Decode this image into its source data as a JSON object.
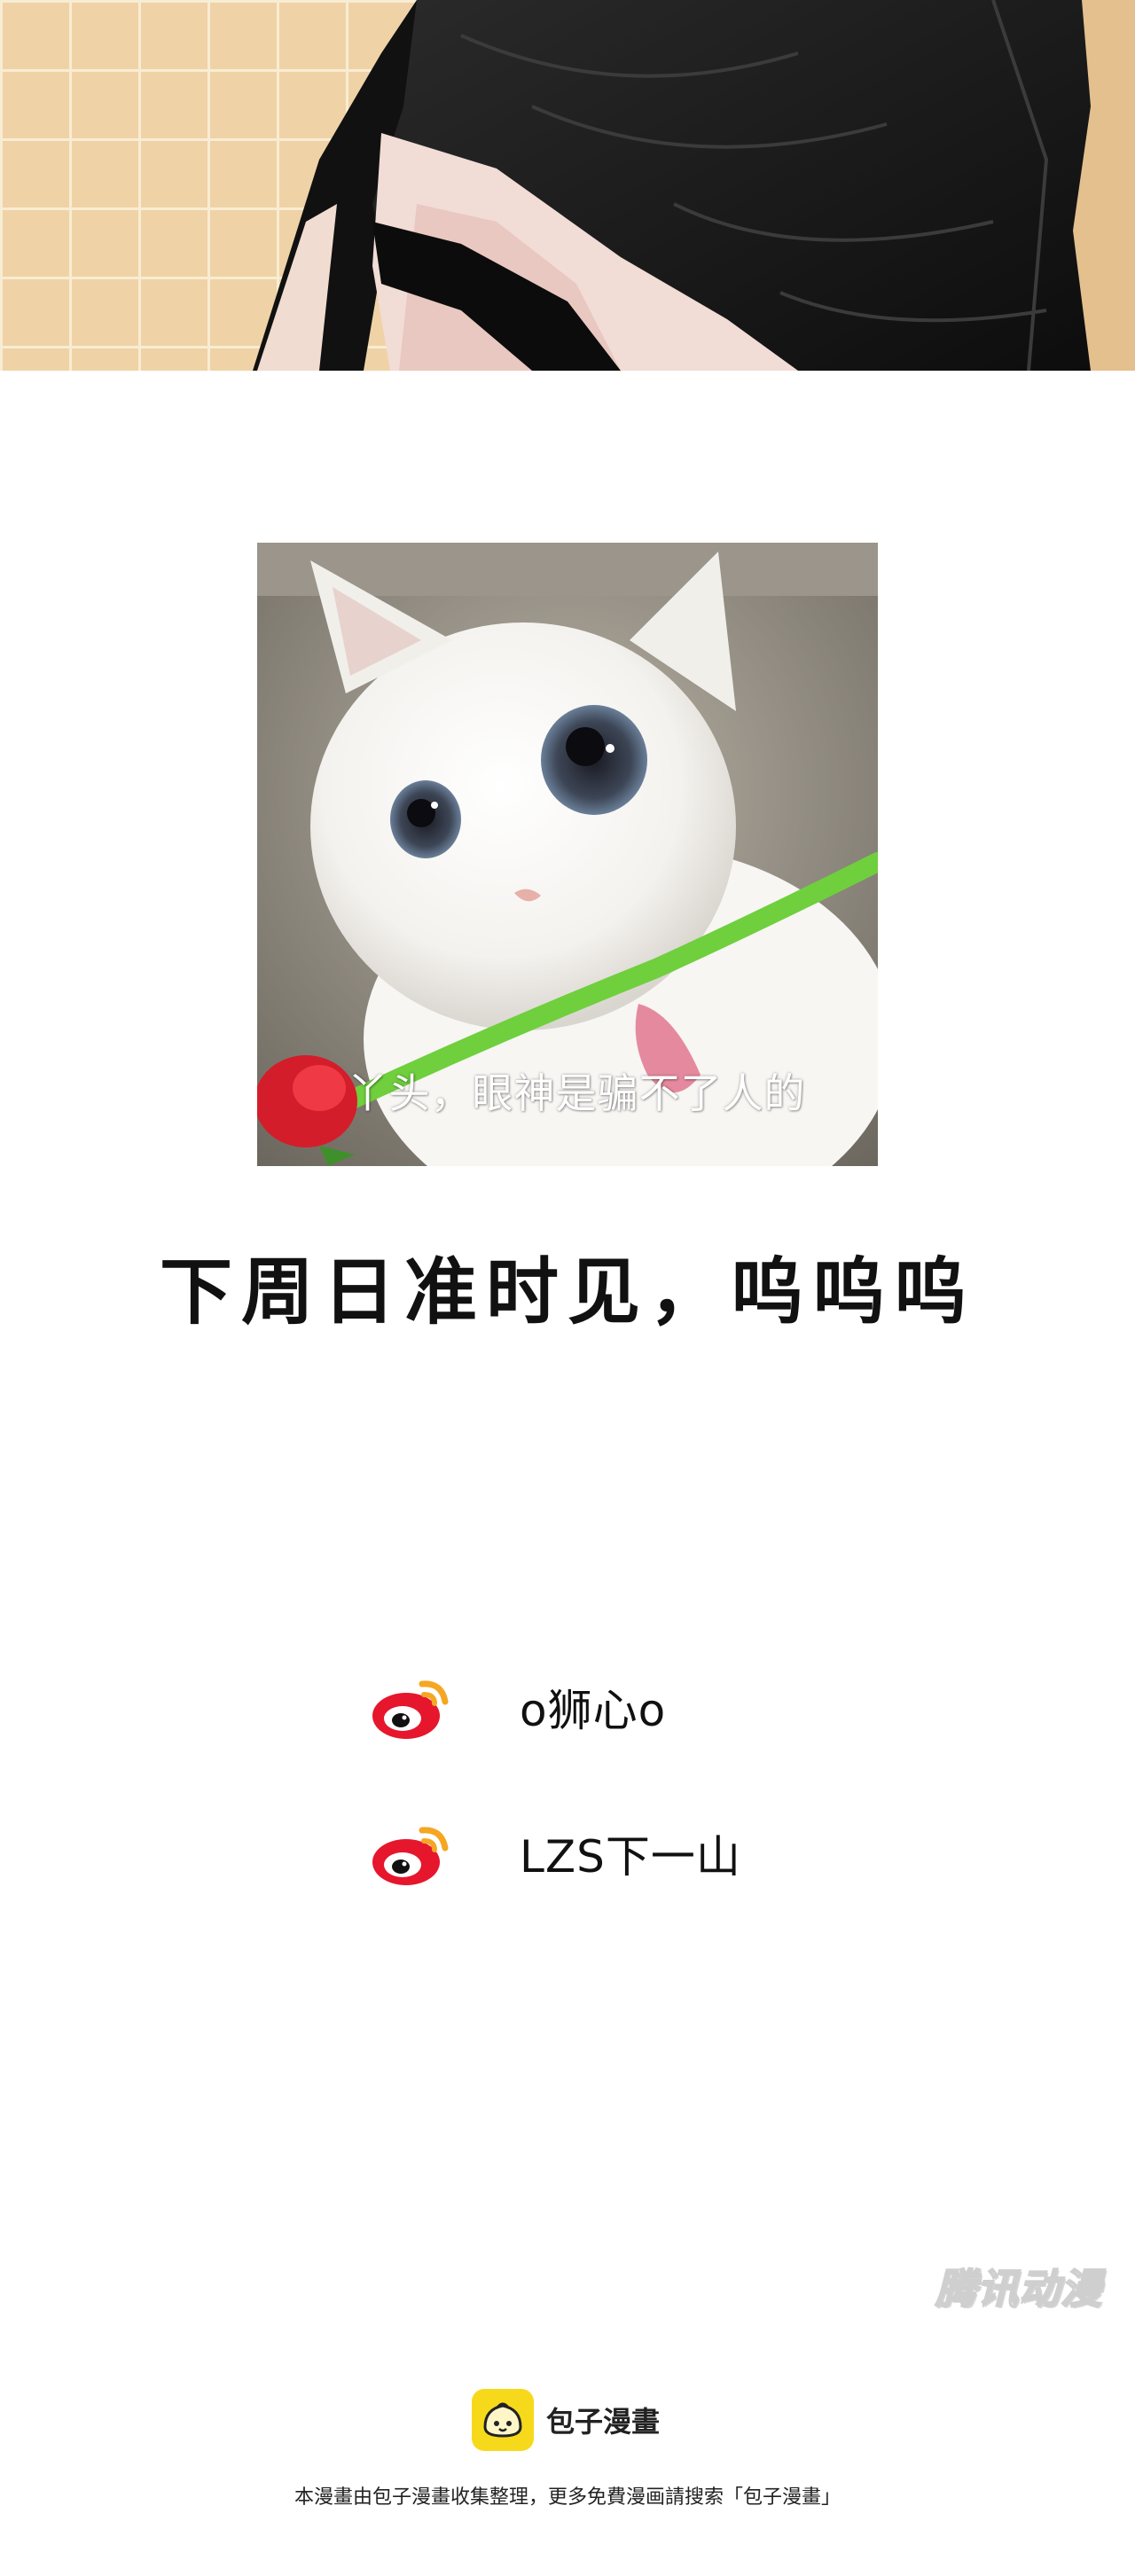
{
  "meme": {
    "caption": "丫头，眼神是骗不了人的"
  },
  "message": "下周日准时见，呜呜呜",
  "credits": [
    {
      "icon": "weibo-icon",
      "name": "o狮心o"
    },
    {
      "icon": "weibo-icon",
      "name": "LZS下一山"
    }
  ],
  "watermark": "腾讯动漫",
  "footer": {
    "logo_text": "包子漫畫",
    "note": "本漫畫由包子漫畫收集整理，更多免費漫画請搜索「包子漫畫」"
  },
  "colors": {
    "weibo_red": "#e6162d",
    "weibo_orange": "#f5a623",
    "logo_yellow": "#f7d91c"
  }
}
